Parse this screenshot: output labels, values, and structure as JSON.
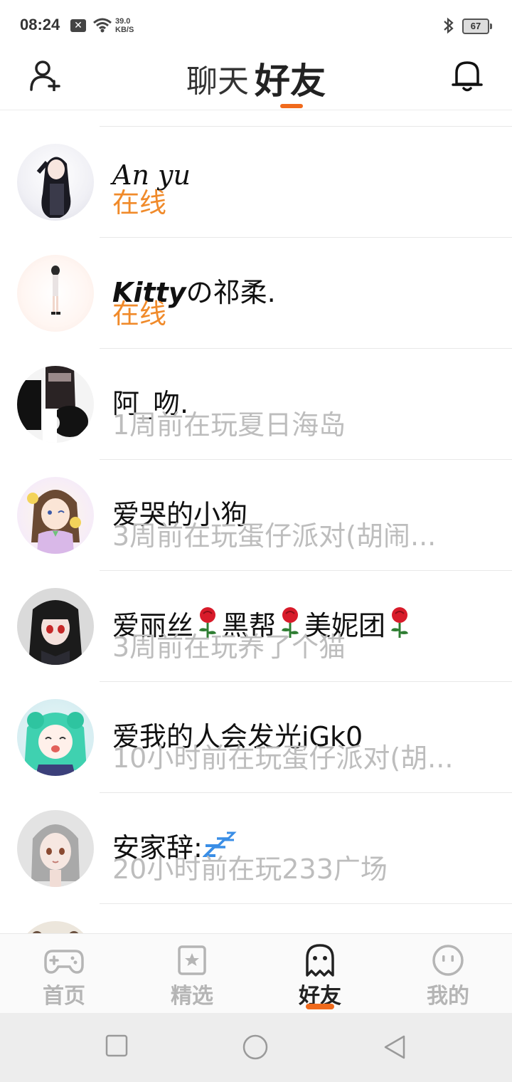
{
  "status_bar": {
    "time": "08:24",
    "notification_icon": "x-icon",
    "net_speed_value": "39.0",
    "net_speed_unit": "KB/S",
    "battery": "67"
  },
  "header": {
    "tab_chat": "聊天",
    "tab_friends": "好友"
  },
  "friends": [
    {
      "name": "An yu",
      "status": "在线",
      "online": true
    },
    {
      "name_prefix": "Kitty",
      "name_suffix": "の祁柔.",
      "status": "在线",
      "online": true
    },
    {
      "name": "阿_吻.",
      "status": "1周前在玩夏日海岛",
      "online": false
    },
    {
      "name": "爱哭的小狗",
      "status": "3周前在玩蛋仔派对(胡闹...",
      "online": false
    },
    {
      "name_parts": [
        "爱丽丝",
        "黑帮",
        "美妮团"
      ],
      "status": "3周前在玩养了个猫",
      "online": false
    },
    {
      "name": "爱我的人会发光iGk0",
      "status": "10小时前在玩蛋仔派对(胡...",
      "online": false
    },
    {
      "name": "安家辞:",
      "status": "20小时前在玩233广场",
      "online": false
    }
  ],
  "bottom_nav": [
    {
      "label": "首页",
      "icon": "gamepad-icon"
    },
    {
      "label": "精选",
      "icon": "star-card-icon"
    },
    {
      "label": "好友",
      "icon": "ghost-icon",
      "active": true
    },
    {
      "label": "我的",
      "icon": "face-icon"
    }
  ],
  "colors": {
    "accent": "#f06a1c",
    "online": "#f08a2a",
    "muted": "#bdbdbd"
  }
}
